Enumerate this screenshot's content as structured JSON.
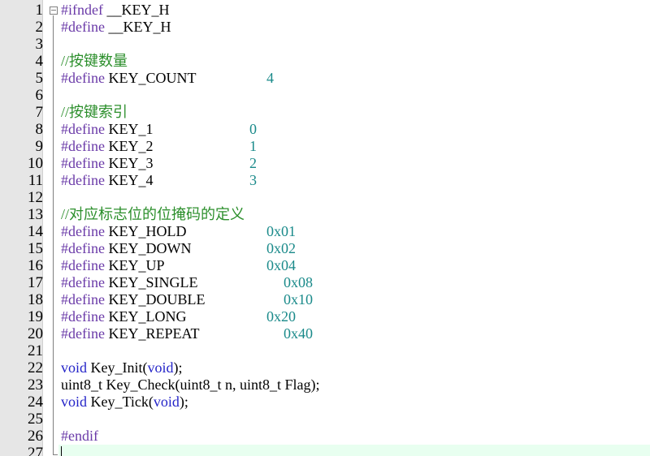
{
  "editor": {
    "colors": {
      "gutter_bg": "#e6e6e6",
      "current_line_bg": "#e8fff0",
      "preprocessor": "#6a3aa8",
      "comment": "#2c8f2c",
      "keyword": "#2424c8",
      "number": "#1a8a8a"
    },
    "fold_icon": "fold-minus-icon",
    "lines": [
      {
        "n": "1",
        "tokens": [
          {
            "t": "pp",
            "v": "#ifndef"
          },
          {
            "t": "id",
            "v": " __KEY_H"
          }
        ]
      },
      {
        "n": "2",
        "tokens": [
          {
            "t": "pp",
            "v": "#define"
          },
          {
            "t": "id",
            "v": " __KEY_H"
          }
        ]
      },
      {
        "n": "3",
        "tokens": []
      },
      {
        "n": "4",
        "tokens": [
          {
            "t": "cm",
            "v": "//按键数量"
          }
        ]
      },
      {
        "n": "5",
        "tokens": [
          {
            "t": "pp",
            "v": "#define"
          },
          {
            "t": "id",
            "v": " KEY_COUNT"
          },
          {
            "t": "num",
            "v": "4",
            "col": "c1"
          }
        ]
      },
      {
        "n": "6",
        "tokens": []
      },
      {
        "n": "7",
        "tokens": [
          {
            "t": "cm",
            "v": "//按键索引"
          }
        ]
      },
      {
        "n": "8",
        "tokens": [
          {
            "t": "pp",
            "v": "#define"
          },
          {
            "t": "id",
            "v": " KEY_1"
          },
          {
            "t": "num",
            "v": "0",
            "col": "c0"
          }
        ]
      },
      {
        "n": "9",
        "tokens": [
          {
            "t": "pp",
            "v": "#define"
          },
          {
            "t": "id",
            "v": " KEY_2"
          },
          {
            "t": "num",
            "v": "1",
            "col": "c0"
          }
        ]
      },
      {
        "n": "10",
        "tokens": [
          {
            "t": "pp",
            "v": "#define"
          },
          {
            "t": "id",
            "v": " KEY_3"
          },
          {
            "t": "num",
            "v": "2",
            "col": "c0"
          }
        ]
      },
      {
        "n": "11",
        "tokens": [
          {
            "t": "pp",
            "v": "#define"
          },
          {
            "t": "id",
            "v": " KEY_4"
          },
          {
            "t": "num",
            "v": "3",
            "col": "c0"
          }
        ]
      },
      {
        "n": "12",
        "tokens": []
      },
      {
        "n": "13",
        "tokens": [
          {
            "t": "cm",
            "v": "//对应标志位的位掩码的定义"
          }
        ]
      },
      {
        "n": "14",
        "tokens": [
          {
            "t": "pp",
            "v": "#define"
          },
          {
            "t": "id",
            "v": " KEY_HOLD"
          },
          {
            "t": "num",
            "v": "0x01",
            "col": "c1"
          }
        ]
      },
      {
        "n": "15",
        "tokens": [
          {
            "t": "pp",
            "v": "#define"
          },
          {
            "t": "id",
            "v": " KEY_DOWN"
          },
          {
            "t": "num",
            "v": "0x02",
            "col": "c1"
          }
        ]
      },
      {
        "n": "16",
        "tokens": [
          {
            "t": "pp",
            "v": "#define"
          },
          {
            "t": "id",
            "v": " KEY_UP"
          },
          {
            "t": "num",
            "v": "0x04",
            "col": "c1"
          }
        ]
      },
      {
        "n": "17",
        "tokens": [
          {
            "t": "pp",
            "v": "#define"
          },
          {
            "t": "id",
            "v": " KEY_SINGLE"
          },
          {
            "t": "num",
            "v": "0x08",
            "col": "c2"
          }
        ]
      },
      {
        "n": "18",
        "tokens": [
          {
            "t": "pp",
            "v": "#define"
          },
          {
            "t": "id",
            "v": " KEY_DOUBLE"
          },
          {
            "t": "num",
            "v": "0x10",
            "col": "c2"
          }
        ]
      },
      {
        "n": "19",
        "tokens": [
          {
            "t": "pp",
            "v": "#define"
          },
          {
            "t": "id",
            "v": " KEY_LONG"
          },
          {
            "t": "num",
            "v": "0x20",
            "col": "c1"
          }
        ]
      },
      {
        "n": "20",
        "tokens": [
          {
            "t": "pp",
            "v": "#define"
          },
          {
            "t": "id",
            "v": " KEY_REPEAT"
          },
          {
            "t": "num",
            "v": "0x40",
            "col": "c2"
          }
        ]
      },
      {
        "n": "21",
        "tokens": []
      },
      {
        "n": "22",
        "tokens": [
          {
            "t": "kw",
            "v": "void"
          },
          {
            "t": "id",
            "v": " Key_Init("
          },
          {
            "t": "kw",
            "v": "void"
          },
          {
            "t": "id",
            "v": ");"
          }
        ]
      },
      {
        "n": "23",
        "tokens": [
          {
            "t": "id",
            "v": "uint8_t Key_Check(uint8_t n, uint8_t Flag);"
          }
        ]
      },
      {
        "n": "24",
        "tokens": [
          {
            "t": "kw",
            "v": "void"
          },
          {
            "t": "id",
            "v": " Key_Tick("
          },
          {
            "t": "kw",
            "v": "void"
          },
          {
            "t": "id",
            "v": ");"
          }
        ]
      },
      {
        "n": "25",
        "tokens": []
      },
      {
        "n": "26",
        "tokens": [
          {
            "t": "pp",
            "v": "#endif"
          }
        ]
      },
      {
        "n": "27",
        "tokens": [],
        "current": true
      }
    ]
  }
}
